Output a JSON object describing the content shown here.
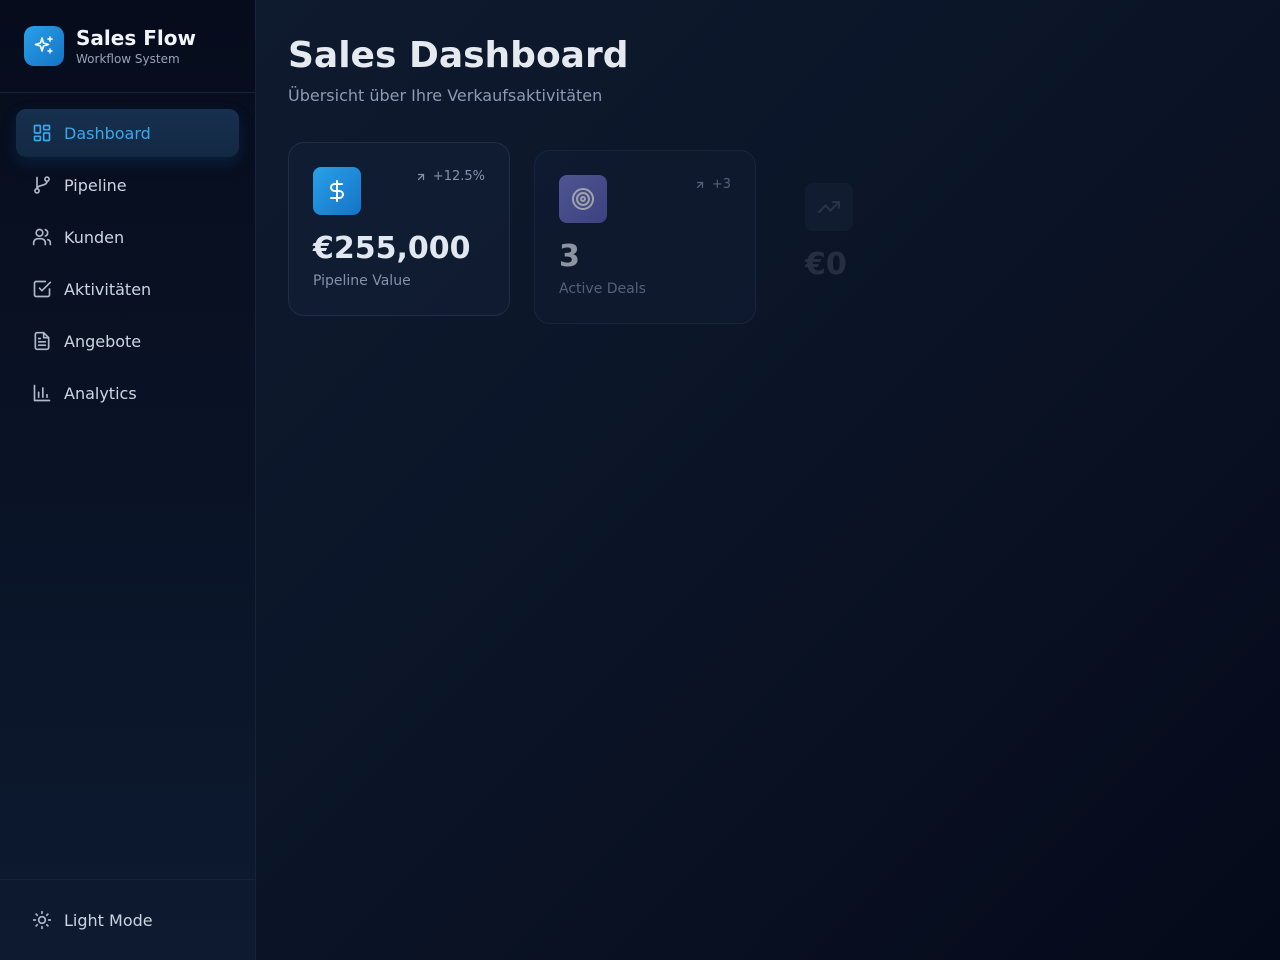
{
  "brand": {
    "title": "Sales Flow",
    "subtitle": "Workflow System",
    "icon": "sparkles-icon",
    "color": "#1e8fdc"
  },
  "sidebar": {
    "items": [
      {
        "label": "Dashboard",
        "icon": "layout-grid-icon",
        "active": true
      },
      {
        "label": "Pipeline",
        "icon": "git-branch-icon",
        "active": false
      },
      {
        "label": "Kunden",
        "icon": "users-icon",
        "active": false
      },
      {
        "label": "Aktivitäten",
        "icon": "check-square-icon",
        "active": false
      },
      {
        "label": "Angebote",
        "icon": "file-text-icon",
        "active": false
      },
      {
        "label": "Analytics",
        "icon": "bar-chart-icon",
        "active": false
      }
    ],
    "footer": {
      "label": "Light Mode",
      "icon": "sun-icon"
    }
  },
  "main": {
    "title": "Sales Dashboard",
    "subtitle": "Übersicht über Ihre Verkaufsaktivitäten",
    "cards": [
      {
        "icon": "dollar-icon",
        "trend": "+12.5%",
        "value": "€255,000",
        "label": "Pipeline Value",
        "color": "#1e8fdc"
      },
      {
        "icon": "target-icon",
        "trend": "+3",
        "value": "3",
        "label": "Active Deals",
        "color": "#6366b5"
      },
      {
        "icon": "trending-up-icon",
        "trend": "",
        "value": "€0",
        "label": "",
        "color": "#3b4a66"
      }
    ]
  },
  "colors": {
    "accent": "#38a8ec",
    "background": "#0c1629",
    "sidebar": "#0a1326"
  }
}
